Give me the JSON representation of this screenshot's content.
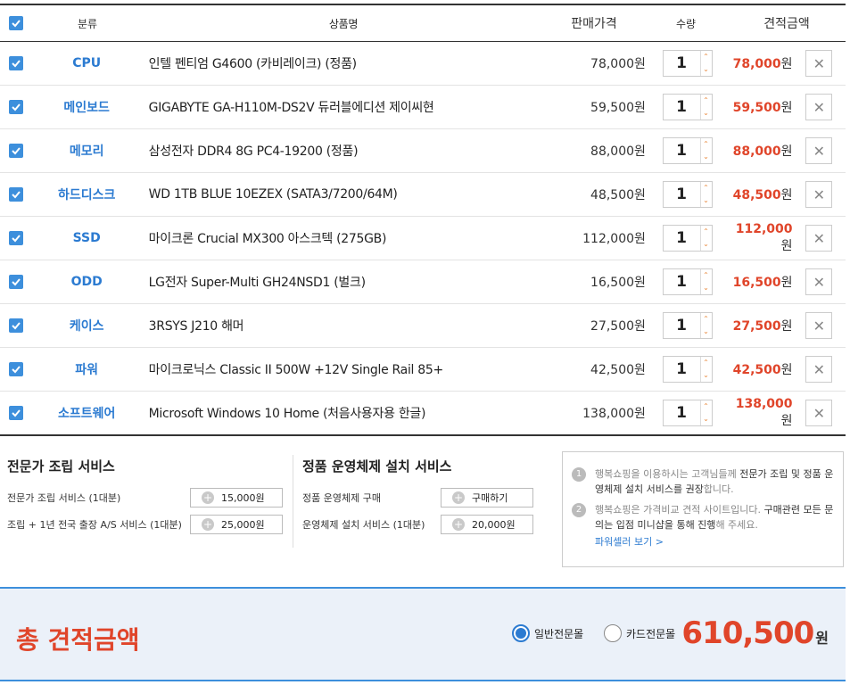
{
  "header": {
    "category": "분류",
    "product": "상품명",
    "price": "판매가격",
    "qty": "수량",
    "total": "견적금액"
  },
  "currency": "원",
  "items": [
    {
      "category": "CPU",
      "name": "인텔 펜티엄 G4600 (카비레이크) (정품)",
      "price": "78,000",
      "qty": "1",
      "total": "78,000"
    },
    {
      "category": "메인보드",
      "name": "GIGABYTE GA-H110M-DS2V 듀러블에디션 제이씨현",
      "price": "59,500",
      "qty": "1",
      "total": "59,500"
    },
    {
      "category": "메모리",
      "name": "삼성전자 DDR4 8G PC4-19200 (정품)",
      "price": "88,000",
      "qty": "1",
      "total": "88,000"
    },
    {
      "category": "하드디스크",
      "name": "WD 1TB BLUE 10EZEX (SATA3/7200/64M)",
      "price": "48,500",
      "qty": "1",
      "total": "48,500"
    },
    {
      "category": "SSD",
      "name": "마이크론 Crucial MX300 아스크텍 (275GB)",
      "price": "112,000",
      "qty": "1",
      "total": "112,000"
    },
    {
      "category": "ODD",
      "name": "LG전자 Super-Multi GH24NSD1 (벌크)",
      "price": "16,500",
      "qty": "1",
      "total": "16,500"
    },
    {
      "category": "케이스",
      "name": "3RSYS J210 해머",
      "price": "27,500",
      "qty": "1",
      "total": "27,500"
    },
    {
      "category": "파워",
      "name": "마이크로닉스 Classic II 500W +12V Single Rail 85+",
      "price": "42,500",
      "qty": "1",
      "total": "42,500"
    },
    {
      "category": "소프트웨어",
      "name": "Microsoft Windows 10 Home (처음사용자용 한글)",
      "price": "138,000",
      "qty": "1",
      "total": "138,000"
    }
  ],
  "assembly": {
    "title": "전문가 조립 서비스",
    "lines": [
      {
        "label": "전문가 조립 서비스 (1대분)",
        "btn": "15,000원"
      },
      {
        "label": "조립 + 1년 전국 출장 A/S 서비스 (1대분)",
        "btn": "25,000원"
      }
    ]
  },
  "os_service": {
    "title": "정품 운영체제 설치 서비스",
    "lines": [
      {
        "label": "정품 운영체제 구매",
        "btn": "구매하기"
      },
      {
        "label": "운영체제 설치 서비스 (1대분)",
        "btn": "20,000원"
      }
    ]
  },
  "notice": {
    "n1": "1",
    "n1_a": "행복쇼핑을 이용하시는 고객님들께 ",
    "n1_b": "전문가 조립 및 정품 운영체제 설치 서비스를 권장",
    "n1_c": "합니다.",
    "n2": "2",
    "n2_a": "행복쇼핑은 가격비교 견적 사이트입니다. ",
    "n2_b": "구매관련 모든 문의는 입점 미니샵을 통해 진행",
    "n2_c": "해 주세요.",
    "link": "파워셀러 보기 >"
  },
  "totalbar": {
    "label": "총 견적금액",
    "radio1": "일반전문몰",
    "radio2": "카드전문몰",
    "amount": "610,500",
    "unit": "원"
  }
}
